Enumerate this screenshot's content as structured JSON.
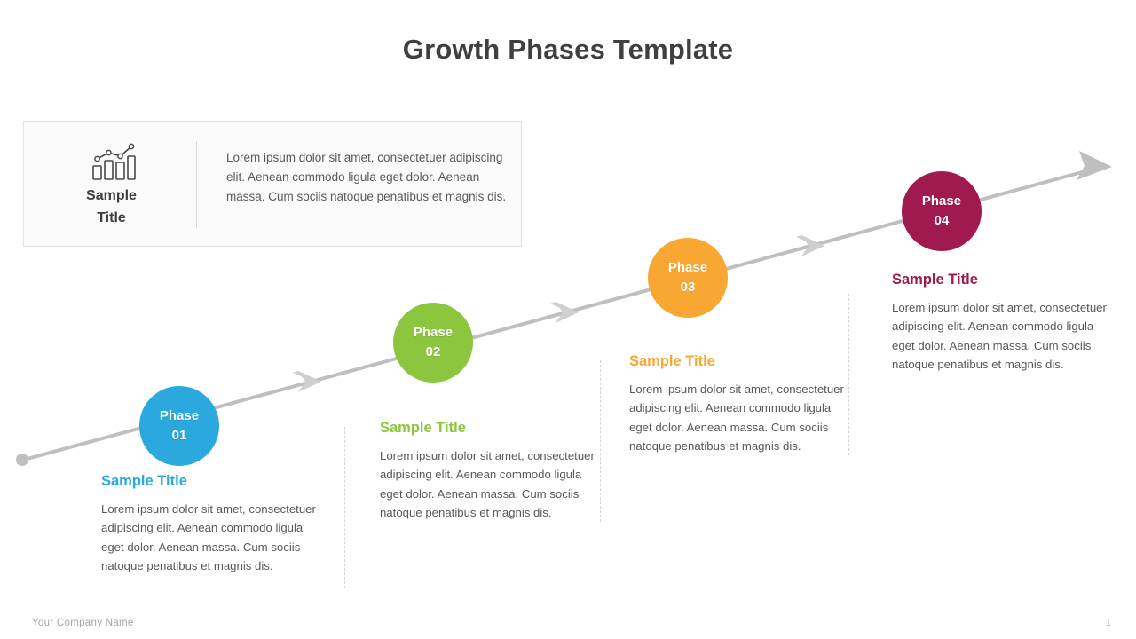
{
  "slide": {
    "title": "Growth Phases Template",
    "background": "#ffffff"
  },
  "info_box": {
    "icon": "bar-chart-line-icon",
    "title_line1": "Sample",
    "title_line2": "Title",
    "body": "Lorem ipsum dolor sit amet, consectetuer adipiscing elit. Aenean commodo  ligula eget dolor.  Aenean massa. Cum sociis natoque penatibus et magnis dis."
  },
  "timeline": {
    "line_color": "#bfbfbf",
    "start_dot": true,
    "chevron_count": 3,
    "end_arrowhead": true
  },
  "phases": [
    {
      "id": "phase-01",
      "label_line1": "Phase",
      "label_line2": "01",
      "color": "#2BA8DD",
      "title": "Sample Title",
      "body": "Lorem ipsum dolor sit amet, consectetuer adipiscing elit. Aenean commodo  ligula eget dolor.  Aenean massa. Cum sociis natoque penatibus et magnis dis."
    },
    {
      "id": "phase-02",
      "label_line1": "Phase",
      "label_line2": "02",
      "color": "#8CC63F",
      "title": "Sample Title",
      "body": "Lorem ipsum dolor sit amet, consectetuer adipiscing elit. Aenean commodo  ligula eget dolor.  Aenean massa. Cum sociis natoque penatibus et magnis dis."
    },
    {
      "id": "phase-03",
      "label_line1": "Phase",
      "label_line2": "03",
      "color": "#F9A733",
      "title": "Sample Title",
      "body": "Lorem ipsum dolor sit amet, consectetuer adipiscing elit. Aenean commodo  ligula eget dolor.  Aenean massa. Cum sociis natoque penatibus et magnis dis."
    },
    {
      "id": "phase-04",
      "label_line1": "Phase",
      "label_line2": "04",
      "color": "#A01A4F",
      "title": "Sample Title",
      "body": "Lorem ipsum dolor sit amet, consectetuer adipiscing elit. Aenean commodo  ligula eget dolor.  Aenean massa. Cum sociis natoque penatibus et magnis dis."
    }
  ],
  "footer": {
    "company": "Your Company Name",
    "page_number": "1"
  }
}
